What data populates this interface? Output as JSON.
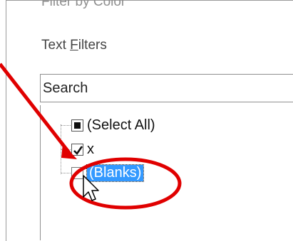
{
  "menu": {
    "filter_by_color": "Filter by Color",
    "text_filters_pre": "Text ",
    "text_filters_accel": "F",
    "text_filters_post": "ilters"
  },
  "search": {
    "placeholder": "Search"
  },
  "list": {
    "items": [
      {
        "label": "(Select All)",
        "state": "indeterminate"
      },
      {
        "label": "x",
        "state": "checked"
      },
      {
        "label": "(Blanks)",
        "state": "unchecked",
        "selected": true
      }
    ]
  },
  "annotation": {
    "color": "#e00000",
    "shapes": [
      "arrow",
      "ellipse"
    ]
  },
  "icons": [
    "mouse-pointer-icon",
    "checkmark-icon"
  ]
}
